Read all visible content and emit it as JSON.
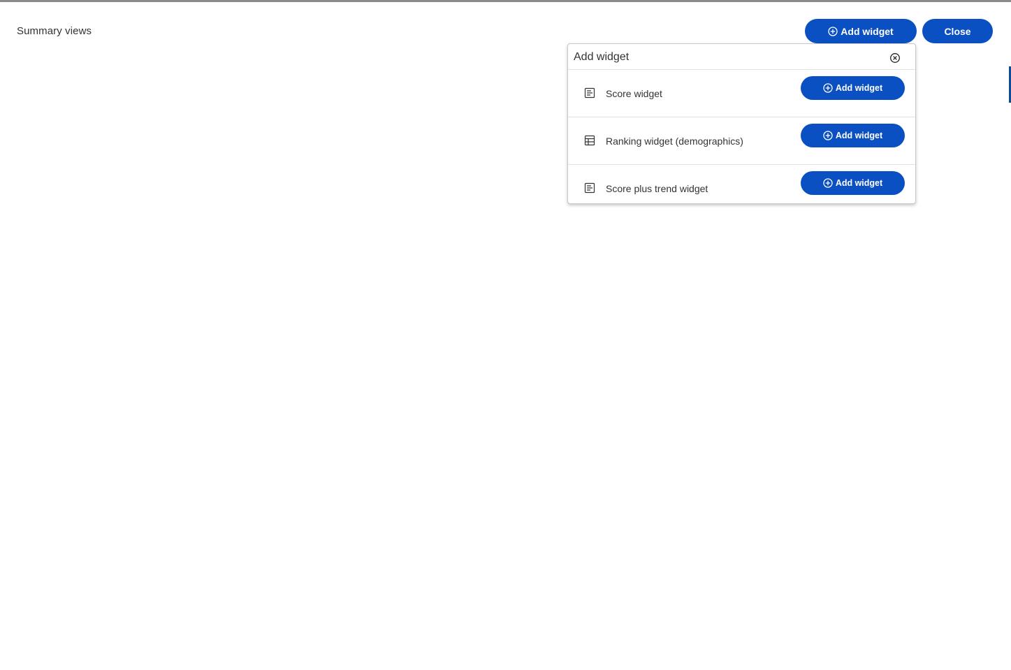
{
  "page": {
    "title": "Summary views"
  },
  "toolbar": {
    "add_widget_label": "Add widget",
    "close_label": "Close"
  },
  "add_widget_panel": {
    "title": "Add widget",
    "items": [
      {
        "label": "Score widget",
        "icon": "text-document-icon",
        "button_label": "Add widget"
      },
      {
        "label": "Ranking widget (demographics)",
        "icon": "table-icon",
        "button_label": "Add widget"
      },
      {
        "label": "Score plus trend widget",
        "icon": "text-document-icon",
        "button_label": "Add widget"
      }
    ]
  },
  "colors": {
    "primary_button": "#0a50c2",
    "text": "#333333",
    "border": "#c8c8c8"
  }
}
